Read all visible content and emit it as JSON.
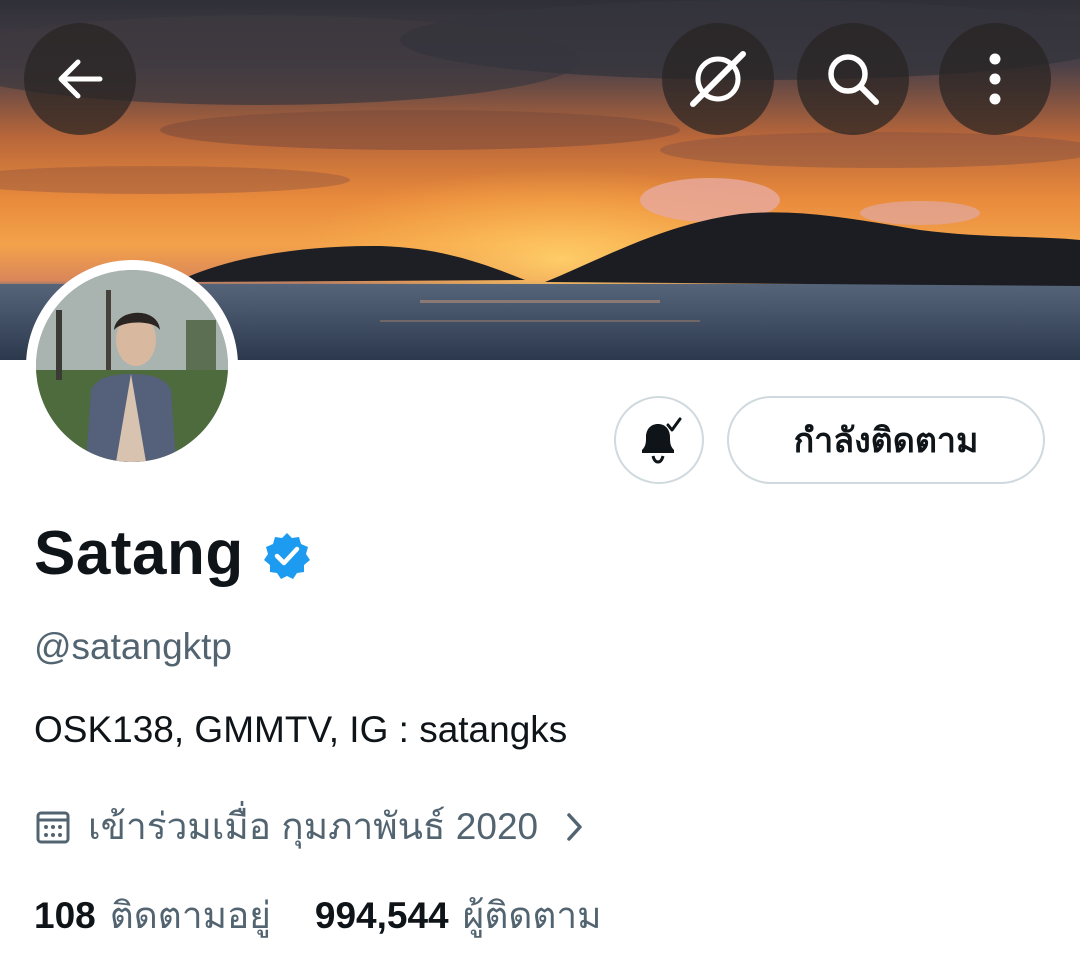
{
  "header": {
    "banner_alt": "sunset over sea and islands",
    "back_icon": "back-arrow-icon",
    "grok_icon": "grok-icon",
    "search_icon": "search-icon",
    "more_icon": "more-vertical-icon"
  },
  "profile": {
    "display_name": "Satang",
    "verified": true,
    "handle": "@satangktp",
    "bio": "OSK138, GMMTV, IG : satangks",
    "joined": "เข้าร่วมเมื่อ กุมภาพันธ์ 2020",
    "following_count": "108",
    "following_label": "ติดตามอยู่",
    "followers_count": "994,544",
    "followers_label": "ผู้ติดตาม"
  },
  "actions": {
    "notify_icon": "bell-check-icon",
    "follow_label": "กำลังติดตาม"
  },
  "colors": {
    "verified_blue": "#1d9bf0",
    "text_primary": "#0f1419",
    "text_secondary": "#536471",
    "border": "#cfd9de"
  }
}
